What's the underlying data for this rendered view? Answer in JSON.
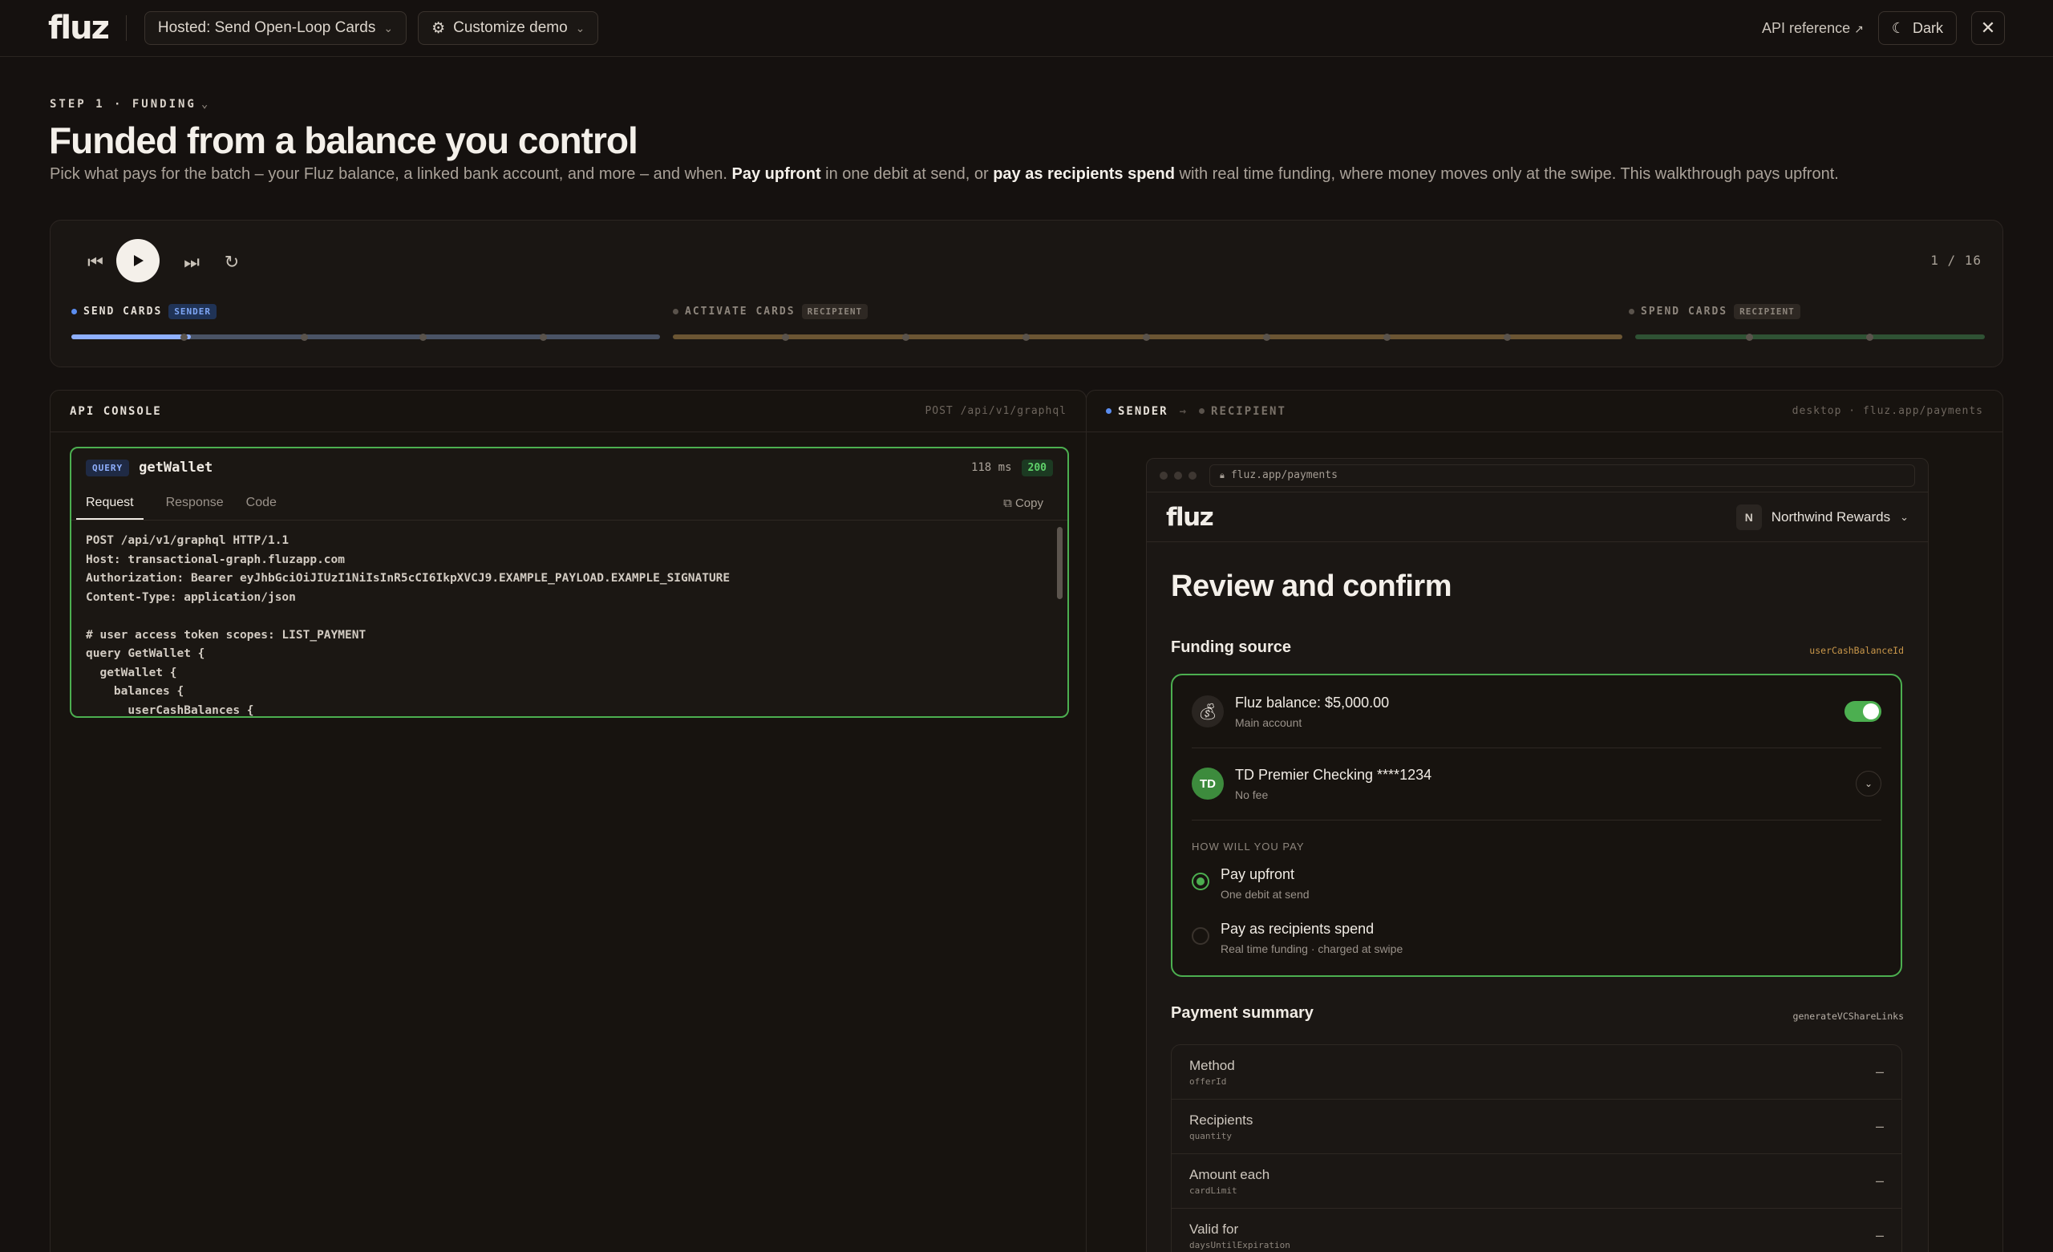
{
  "topbar": {
    "logo": "fluz",
    "flow_select": "Hosted: Send Open-Loop Cards",
    "customize_label": "Customize demo",
    "api_reference": "API reference",
    "theme_label": "Dark"
  },
  "header": {
    "step_label": "STEP 1 · FUNDING",
    "title": "Funded from a balance you control",
    "sub_1": "Pick what pays for the batch – your Fluz balance, a linked bank account, and more – and when. ",
    "sub_b1": "Pay upfront",
    "sub_2": " in one debit at send, or ",
    "sub_b2": "pay as recipients spend",
    "sub_3": " with real time funding, where money moves only at the swipe. This walkthrough pays upfront."
  },
  "player": {
    "counter": "1 / 16",
    "progress_fraction": 0.0625,
    "phases": [
      {
        "label": "SEND CARDS",
        "tag": "SENDER",
        "color": "#5b8def"
      },
      {
        "label": "ACTIVATE CARDS",
        "tag": "RECIPIENT",
        "color": "#b38a4a"
      },
      {
        "label": "SPEND CARDS",
        "tag": "RECIPIENT",
        "color": "#4f9a56"
      }
    ]
  },
  "console": {
    "title": "API CONSOLE",
    "endpoint": "POST /api/v1/graphql",
    "query_badge": "QUERY",
    "query_name": "getWallet",
    "latency": "118 ms",
    "status": "200",
    "tabs": [
      "Request",
      "Response",
      "Code"
    ],
    "copy_label": "⧉ Copy",
    "code": "POST /api/v1/graphql HTTP/1.1\nHost: transactional-graph.fluzapp.com\nAuthorization: Bearer eyJhbGciOiJIUzI1NiIsInR5cCI6IkpXVCJ9.EXAMPLE_PAYLOAD.EXAMPLE_SIGNATURE\nContent-Type: application/json\n\n# user access token scopes: LIST_PAYMENT\nquery GetWallet {\n  getWallet {\n    balances {\n      userCashBalances {"
  },
  "preview": {
    "sender_label": "SENDER",
    "recipient_label": "RECIPIENT",
    "context": "desktop · fluz.app/payments",
    "url": "fluz.app/payments",
    "app_logo": "fluz",
    "org_initial": "N",
    "org_name": "Northwind Rewards",
    "title": "Review and confirm",
    "funding_title": "Funding source",
    "funding_key": "userCashBalanceId",
    "balance_main": "Fluz balance: $5,000.00",
    "balance_sub": "Main account",
    "bank_main": "TD Premier Checking ****1234",
    "bank_sub": "No fee",
    "bank_logo": "TD",
    "how_label": "HOW WILL YOU PAY",
    "opt1_main": "Pay upfront",
    "opt1_sub": "One debit at send",
    "opt2_main": "Pay as recipients spend",
    "opt2_sub": "Real time funding · charged at swipe",
    "summary_title": "Payment summary",
    "summary_key": "generateVCShareLinks",
    "summary": [
      {
        "label": "Method",
        "key": "offerId",
        "value": "–"
      },
      {
        "label": "Recipients",
        "key": "quantity",
        "value": "–"
      },
      {
        "label": "Amount each",
        "key": "cardLimit",
        "value": "–"
      },
      {
        "label": "Valid for",
        "key": "daysUntilExpiration",
        "value": "–"
      }
    ]
  }
}
